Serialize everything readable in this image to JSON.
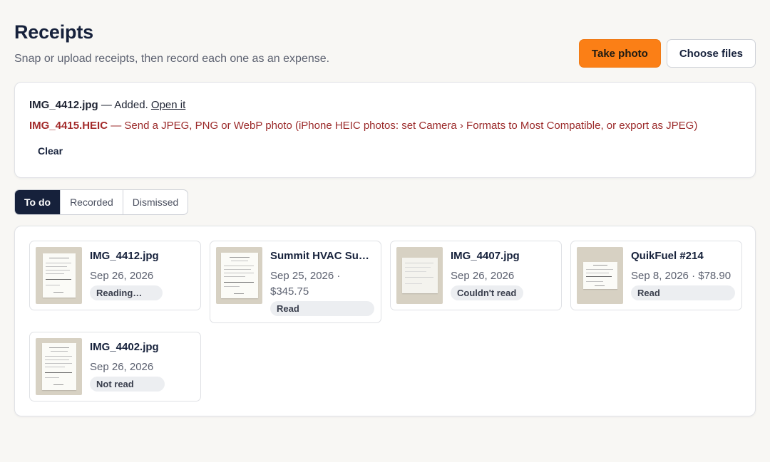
{
  "header": {
    "title": "Receipts",
    "subtitle": "Snap or upload receipts, then record each one as an expense.",
    "take_photo_label": "Take photo",
    "choose_files_label": "Choose files"
  },
  "notice": {
    "added_file": "IMG_4412.jpg",
    "added_text": " — Added. ",
    "open_link": "Open it",
    "error_file": "IMG_4415.HEIC",
    "error_text": " — Send a JPEG, PNG or WebP photo (iPhone HEIC photos: set Camera › Formats to Most Compatible, or export as JPEG)",
    "clear_label": "Clear"
  },
  "tabs": [
    {
      "label": "To do",
      "active": true
    },
    {
      "label": "Recorded",
      "active": false
    },
    {
      "label": "Dismissed",
      "active": false
    }
  ],
  "receipts": [
    {
      "title": "IMG_4412.jpg",
      "meta": "Sep 26, 2026",
      "status": "Reading…"
    },
    {
      "title": "Summit HVAC Supply",
      "meta": "Sep 25, 2026 · $345.75",
      "status": "Read"
    },
    {
      "title": "IMG_4407.jpg",
      "meta": "Sep 26, 2026",
      "status": "Couldn't read"
    },
    {
      "title": "QuikFuel #214",
      "meta": "Sep 8, 2026 · $78.90",
      "status": "Read"
    },
    {
      "title": "IMG_4402.jpg",
      "meta": "Sep 26, 2026",
      "status": "Not read"
    }
  ],
  "colors": {
    "accent": "#fb7f16",
    "navy": "#16213b",
    "error": "#a32a2a",
    "thumb_bg": "#d7d1c3"
  }
}
